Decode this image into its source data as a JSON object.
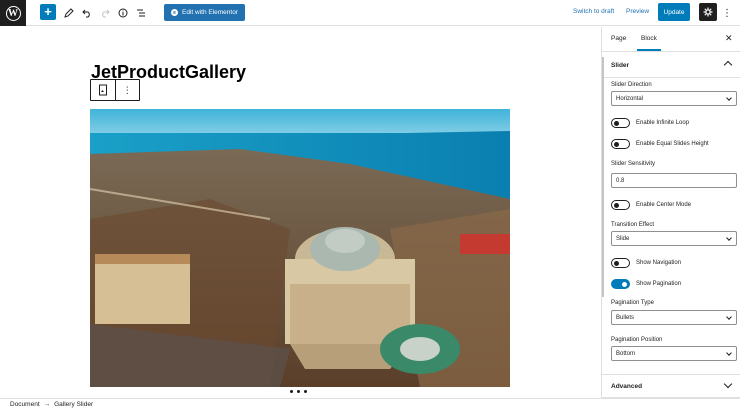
{
  "toolbar": {
    "inserter": "+",
    "elementor_label": "Edit with Elementor",
    "switch_to_draft": "Switch to draft",
    "preview": "Preview",
    "update": "Update"
  },
  "editor": {
    "title": "JetProductGallery",
    "pagination_dots": 3
  },
  "sidebar": {
    "tabs": [
      "Page",
      "Block"
    ],
    "active_tab": "Block",
    "panel_title": "Slider",
    "slider_direction_label": "Slider Direction",
    "slider_direction_value": "Horizontal",
    "toggle_infinite_loop": "Enable Infinite Loop",
    "toggle_equal_height": "Enable Equal Slides Height",
    "sensitivity_label": "Slider Sensitivity",
    "sensitivity_value": "0.8",
    "toggle_center_mode": "Enable Center Mode",
    "transition_label": "Transition Effect",
    "transition_value": "Slide",
    "toggle_show_navigation": "Show Navigation",
    "toggle_show_pagination": "Show Pagination",
    "pagination_type_label": "Pagination Type",
    "pagination_type_value": "Bullets",
    "pagination_position_label": "Pagination Position",
    "pagination_position_value": "Bottom",
    "advanced_title": "Advanced",
    "toggles_state": {
      "infinite_loop": false,
      "equal_height": false,
      "center_mode": false,
      "show_navigation": false,
      "show_pagination": true
    }
  },
  "footer": {
    "crumb_root": "Document",
    "separator": "→",
    "crumb_current": "Gallery Slider"
  },
  "colors": {
    "accent": "#007cba",
    "elementor": "#2271b1",
    "dark": "#1e1e1e"
  }
}
